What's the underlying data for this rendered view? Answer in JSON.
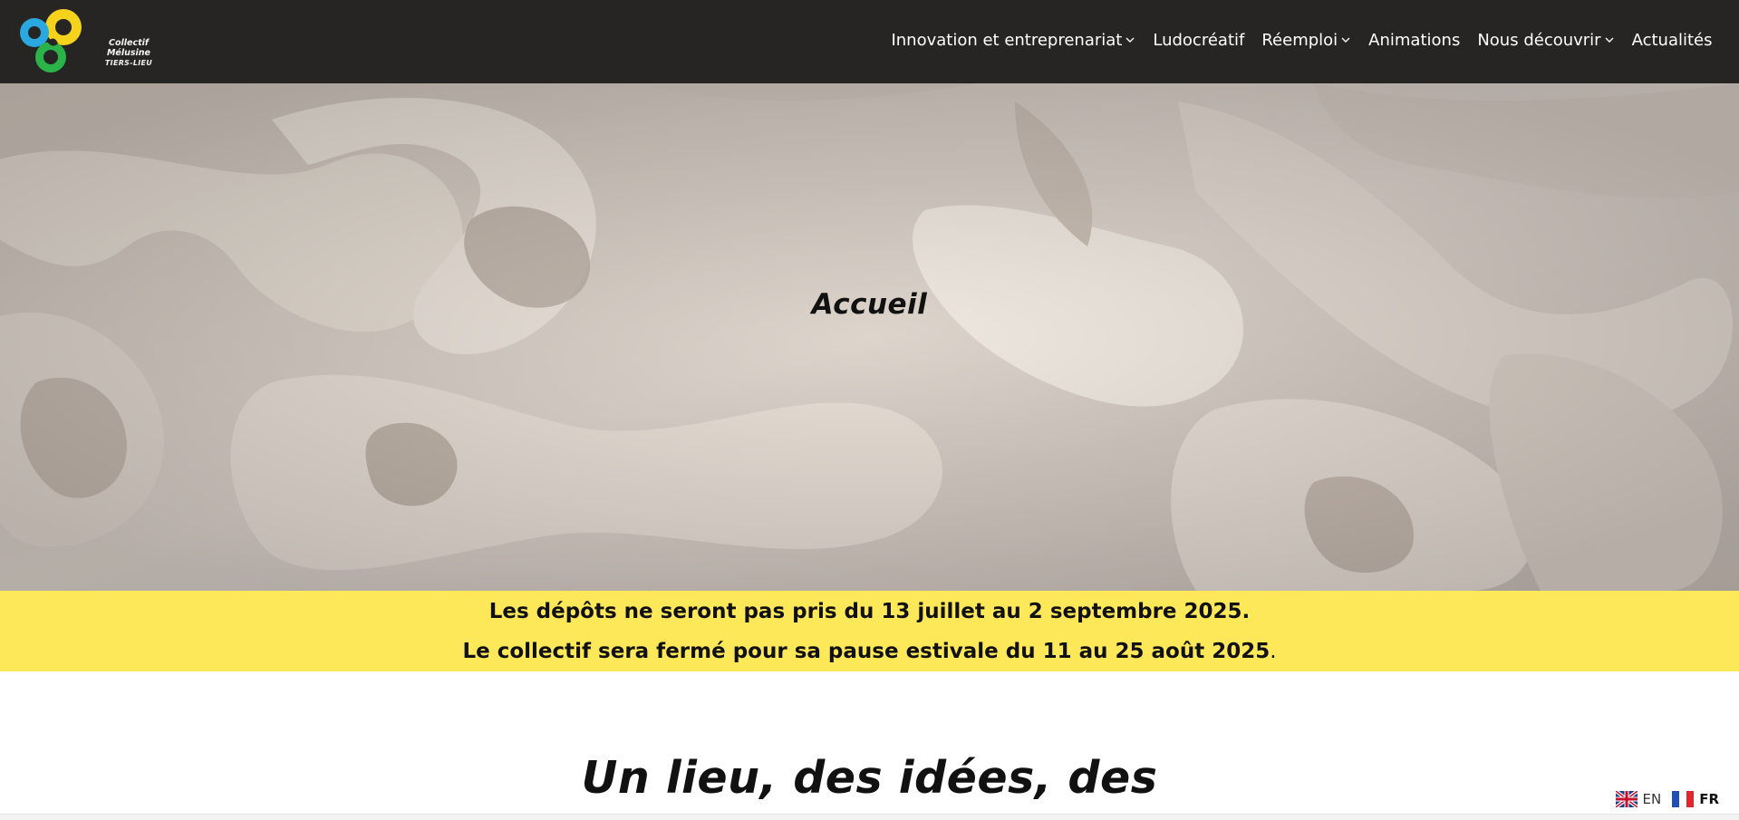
{
  "header": {
    "logo": {
      "line1": "Collectif Mélusine",
      "line2": "TIERS-LIEU"
    },
    "nav": [
      {
        "label": "Innovation et entreprenariat",
        "has_dropdown": true
      },
      {
        "label": "Ludocréatif",
        "has_dropdown": false
      },
      {
        "label": "Réemploi",
        "has_dropdown": true
      },
      {
        "label": "Animations",
        "has_dropdown": false
      },
      {
        "label": "Nous découvrir",
        "has_dropdown": true
      },
      {
        "label": "Actualités",
        "has_dropdown": false
      }
    ]
  },
  "hero": {
    "title": "Accueil"
  },
  "notice": {
    "line1": "Les dépôts ne seront pas pris du 13 juillet au 2 septembre 2025.",
    "line2": "Le collectif sera fermé pour sa pause estivale du 11 au 25 août 2025",
    "line2_suffix": "."
  },
  "main": {
    "heading": "Un lieu, des idées, des"
  },
  "language_switcher": {
    "languages": [
      {
        "code": "EN",
        "flag": "uk-flag-icon",
        "active": false
      },
      {
        "code": "FR",
        "flag": "france-flag-icon",
        "active": true
      }
    ]
  },
  "colors": {
    "header_bg": "#262524",
    "notice_bg": "#fde85a",
    "logo_blue": "#2aa9e0",
    "logo_yellow": "#f5d21c",
    "logo_green": "#2bb34a"
  }
}
